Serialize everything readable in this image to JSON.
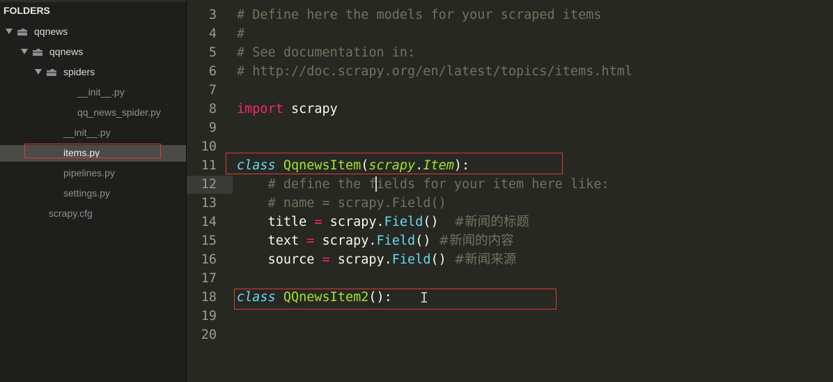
{
  "sidebar": {
    "header": "FOLDERS",
    "tree": [
      {
        "label": "qqnews",
        "type": "folder",
        "depth": 0,
        "expanded": true
      },
      {
        "label": "qqnews",
        "type": "folder",
        "depth": 1,
        "expanded": true
      },
      {
        "label": "spiders",
        "type": "folder",
        "depth": 2,
        "expanded": true
      },
      {
        "label": "__init__.py",
        "type": "file",
        "depth": 3
      },
      {
        "label": "qq_news_spider.py",
        "type": "file",
        "depth": 3
      },
      {
        "label": "__init__.py",
        "type": "file",
        "depth": 2
      },
      {
        "label": "items.py",
        "type": "file",
        "depth": 2,
        "selected": true
      },
      {
        "label": "pipelines.py",
        "type": "file",
        "depth": 2
      },
      {
        "label": "settings.py",
        "type": "file",
        "depth": 2
      },
      {
        "label": "scrapy.cfg",
        "type": "file",
        "depth": 1
      }
    ]
  },
  "editor": {
    "active_line": 12,
    "lines": [
      {
        "n": "3",
        "t": [
          [
            "cmt",
            "# Define here the models for your scraped items"
          ]
        ]
      },
      {
        "n": "4",
        "t": [
          [
            "cmt",
            "#"
          ]
        ]
      },
      {
        "n": "5",
        "t": [
          [
            "cmt",
            "# See documentation in:"
          ]
        ]
      },
      {
        "n": "6",
        "t": [
          [
            "cmt",
            "# http://doc.scrapy.org/en/latest/topics/items.html"
          ]
        ]
      },
      {
        "n": "7",
        "t": []
      },
      {
        "n": "8",
        "t": [
          [
            "kw",
            "import"
          ],
          [
            "",
            " scrapy"
          ]
        ]
      },
      {
        "n": "9",
        "t": []
      },
      {
        "n": "10",
        "t": []
      },
      {
        "n": "11",
        "t": [
          [
            "st",
            "class"
          ],
          [
            "",
            " "
          ],
          [
            "cls",
            "QqnewsItem"
          ],
          [
            "",
            "("
          ],
          [
            "inh",
            "scrapy"
          ],
          [
            "",
            "."
          ],
          [
            "inh",
            "Item"
          ],
          [
            "",
            "):"
          ]
        ]
      },
      {
        "n": "12",
        "t": [
          [
            "",
            "    "
          ],
          [
            "cmt",
            "# define the fields for your item here like:"
          ]
        ]
      },
      {
        "n": "13",
        "t": [
          [
            "",
            "    "
          ],
          [
            "cmt",
            "# name = scrapy.Field()"
          ]
        ]
      },
      {
        "n": "14",
        "t": [
          [
            "",
            "    title "
          ],
          [
            "op",
            "="
          ],
          [
            "",
            " scrapy."
          ],
          [
            "fn",
            "Field"
          ],
          [
            "",
            "()  "
          ],
          [
            "cmt cjk",
            "#新闻的标题"
          ]
        ]
      },
      {
        "n": "15",
        "t": [
          [
            "",
            "    text "
          ],
          [
            "op",
            "="
          ],
          [
            "",
            " scrapy."
          ],
          [
            "fn",
            "Field"
          ],
          [
            "",
            "() "
          ],
          [
            "cmt cjk",
            "#新闻的内容"
          ]
        ]
      },
      {
        "n": "16",
        "t": [
          [
            "",
            "    source "
          ],
          [
            "op",
            "="
          ],
          [
            "",
            " scrapy."
          ],
          [
            "fn",
            "Field"
          ],
          [
            "",
            "() "
          ],
          [
            "cmt cjk",
            "#新闻来源"
          ]
        ]
      },
      {
        "n": "17",
        "t": []
      },
      {
        "n": "18",
        "t": [
          [
            "st",
            "class"
          ],
          [
            "",
            " "
          ],
          [
            "cls",
            "QQnewsItem2"
          ],
          [
            "",
            "():"
          ]
        ]
      },
      {
        "n": "19",
        "t": []
      },
      {
        "n": "20",
        "t": []
      }
    ]
  },
  "annotations": {
    "highlight_color": "#e03a3a"
  },
  "cursor": {
    "ibeam": "I"
  }
}
